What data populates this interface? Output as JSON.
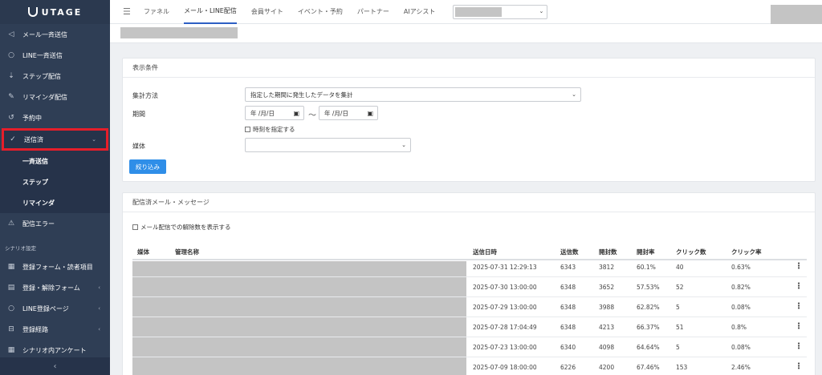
{
  "sidebar": {
    "logo_text": "UTAGE",
    "items": [
      {
        "label": "メール一斉送信",
        "icon": "send-icon"
      },
      {
        "label": "LINE一斉送信",
        "icon": "chat-icon"
      },
      {
        "label": "ステップ配信",
        "icon": "step-icon"
      },
      {
        "label": "リマインダ配信",
        "icon": "pencil-icon"
      },
      {
        "label": "予約中",
        "icon": "history-icon"
      },
      {
        "label": "送信済",
        "icon": "check-icon"
      }
    ],
    "subitems": [
      {
        "label": "一斉送信"
      },
      {
        "label": "ステップ"
      },
      {
        "label": "リマインダ"
      }
    ],
    "error_item": {
      "label": "配信エラー",
      "icon": "warning-icon"
    },
    "section_label": "シナリオ設定",
    "scenario_items": [
      {
        "label": "登録フォーム・読者項目",
        "icon": "table-icon"
      },
      {
        "label": "登録・解除フォーム",
        "icon": "form-icon"
      },
      {
        "label": "LINE登録ページ",
        "icon": "chat-icon"
      },
      {
        "label": "登録経路",
        "icon": "route-icon"
      },
      {
        "label": "シナリオ内アンケート",
        "icon": "table-icon"
      }
    ]
  },
  "topbar": {
    "tabs": [
      "ファネル",
      "メール・LINE配信",
      "会員サイト",
      "イベント・予約",
      "パートナー",
      "AIアシスト"
    ],
    "active_tab": "メール・LINE配信"
  },
  "filter": {
    "title": "表示条件",
    "aggregation_label": "集計方法",
    "aggregation_value": "指定した期間に発生したデータを集計",
    "period_label": "期間",
    "date_placeholder": "年 /月/日",
    "tilde": "〜",
    "time_checkbox_label": "時刻を指定する",
    "media_label": "媒体",
    "media_value": "",
    "filter_button": "絞り込み"
  },
  "sent": {
    "title": "配信済メール・メッセージ",
    "unsub_checkbox_label": "メール配信での解除数を表示する",
    "columns": [
      "媒体",
      "管理名称",
      "送信日時",
      "送信数",
      "開封数",
      "開封率",
      "クリック数",
      "クリック率"
    ],
    "rows": [
      {
        "datetime": "2025-07-31 12:29:13",
        "sent": "6343",
        "opened": "3812",
        "open_rate": "60.1%",
        "clicks": "40",
        "click_rate": "0.63%"
      },
      {
        "datetime": "2025-07-30 13:00:00",
        "sent": "6348",
        "opened": "3652",
        "open_rate": "57.53%",
        "clicks": "52",
        "click_rate": "0.82%"
      },
      {
        "datetime": "2025-07-29 13:00:00",
        "sent": "6348",
        "opened": "3988",
        "open_rate": "62.82%",
        "clicks": "5",
        "click_rate": "0.08%"
      },
      {
        "datetime": "2025-07-28 17:04:49",
        "sent": "6348",
        "opened": "4213",
        "open_rate": "66.37%",
        "clicks": "51",
        "click_rate": "0.8%"
      },
      {
        "datetime": "2025-07-23 13:00:00",
        "sent": "6340",
        "opened": "4098",
        "open_rate": "64.64%",
        "clicks": "5",
        "click_rate": "0.08%"
      },
      {
        "datetime": "2025-07-09 18:00:00",
        "sent": "6226",
        "opened": "4200",
        "open_rate": "67.46%",
        "clicks": "153",
        "click_rate": "2.46%"
      }
    ]
  }
}
